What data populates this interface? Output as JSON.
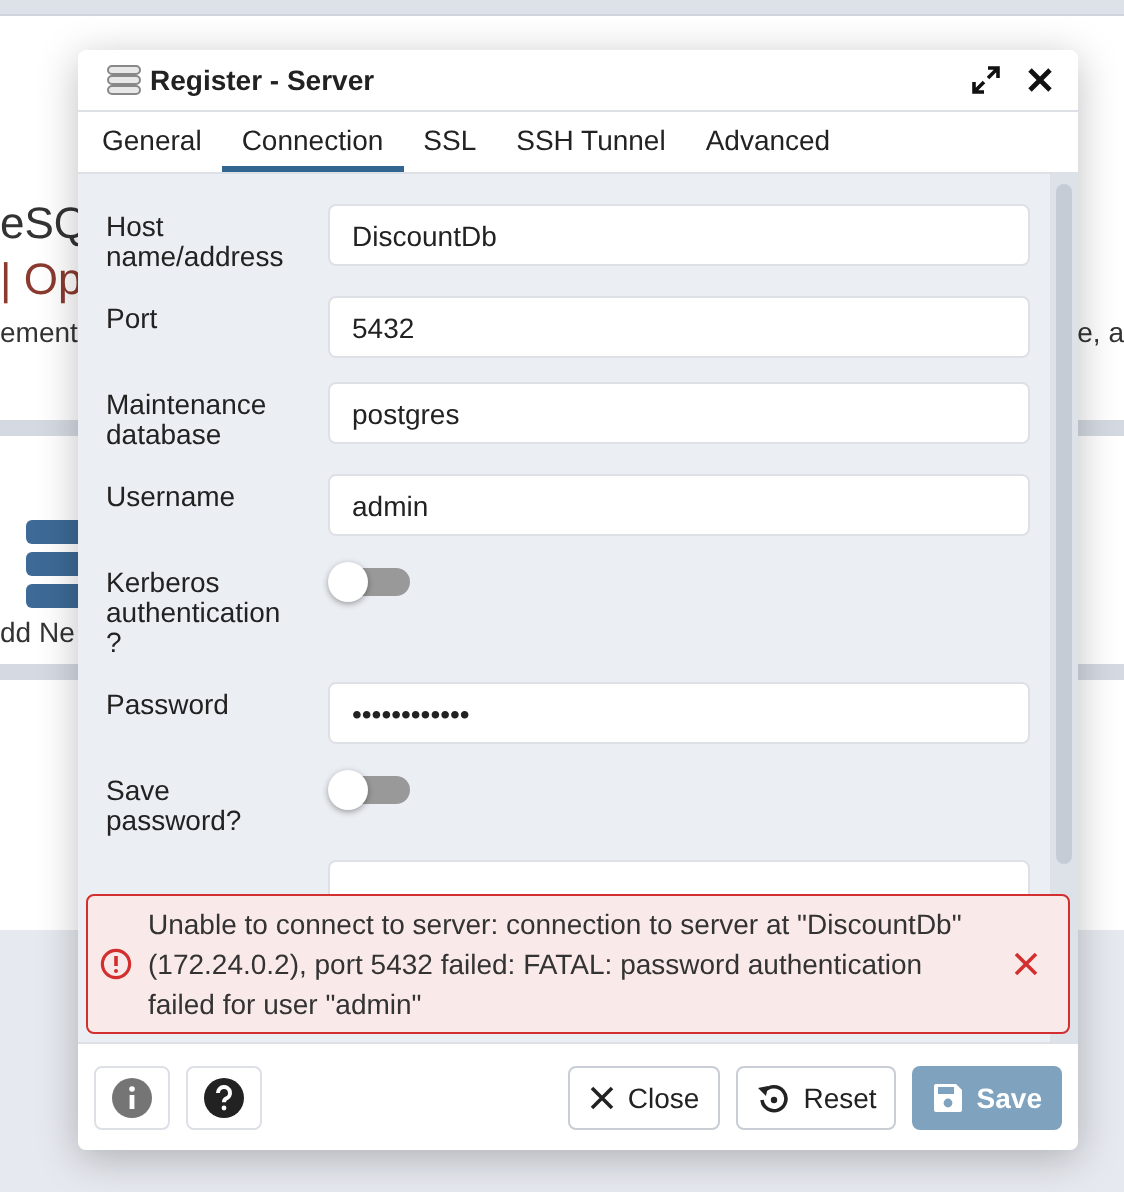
{
  "background": {
    "heading": "eSQ",
    "subheading": "| Op",
    "text_left": "ement",
    "text_right": "e, a",
    "add_label": "dd Ne"
  },
  "dialog": {
    "title": "Register - Server",
    "tabs": [
      {
        "label": "General",
        "selected": false
      },
      {
        "label": "Connection",
        "selected": true
      },
      {
        "label": "SSL",
        "selected": false
      },
      {
        "label": "SSH Tunnel",
        "selected": false
      },
      {
        "label": "Advanced",
        "selected": false
      }
    ],
    "fields": [
      {
        "kind": "text",
        "label": "Host name/address",
        "value": "DiscountDb"
      },
      {
        "kind": "text",
        "label": "Port",
        "value": "5432"
      },
      {
        "kind": "text",
        "label": "Maintenance database",
        "value": "postgres"
      },
      {
        "kind": "text",
        "label": "Username",
        "value": "admin"
      },
      {
        "kind": "toggle",
        "label": "Kerberos authentication?",
        "on": false
      },
      {
        "kind": "text",
        "label": "Password",
        "value": "••••••••••••"
      },
      {
        "kind": "toggle",
        "label": "Save password?",
        "on": false
      },
      {
        "kind": "text"
      }
    ],
    "error": "Unable to connect to server: connection to server at \"DiscountDb\" (172.24.0.2), port 5432 failed: FATAL: password authentication failed for user \"admin\"",
    "buttons": [
      {
        "kind": "close",
        "label": "Close",
        "disabled": false
      },
      {
        "kind": "reset",
        "label": "Reset",
        "disabled": false
      },
      {
        "kind": "save",
        "label": "Save",
        "disabled": true
      }
    ]
  }
}
